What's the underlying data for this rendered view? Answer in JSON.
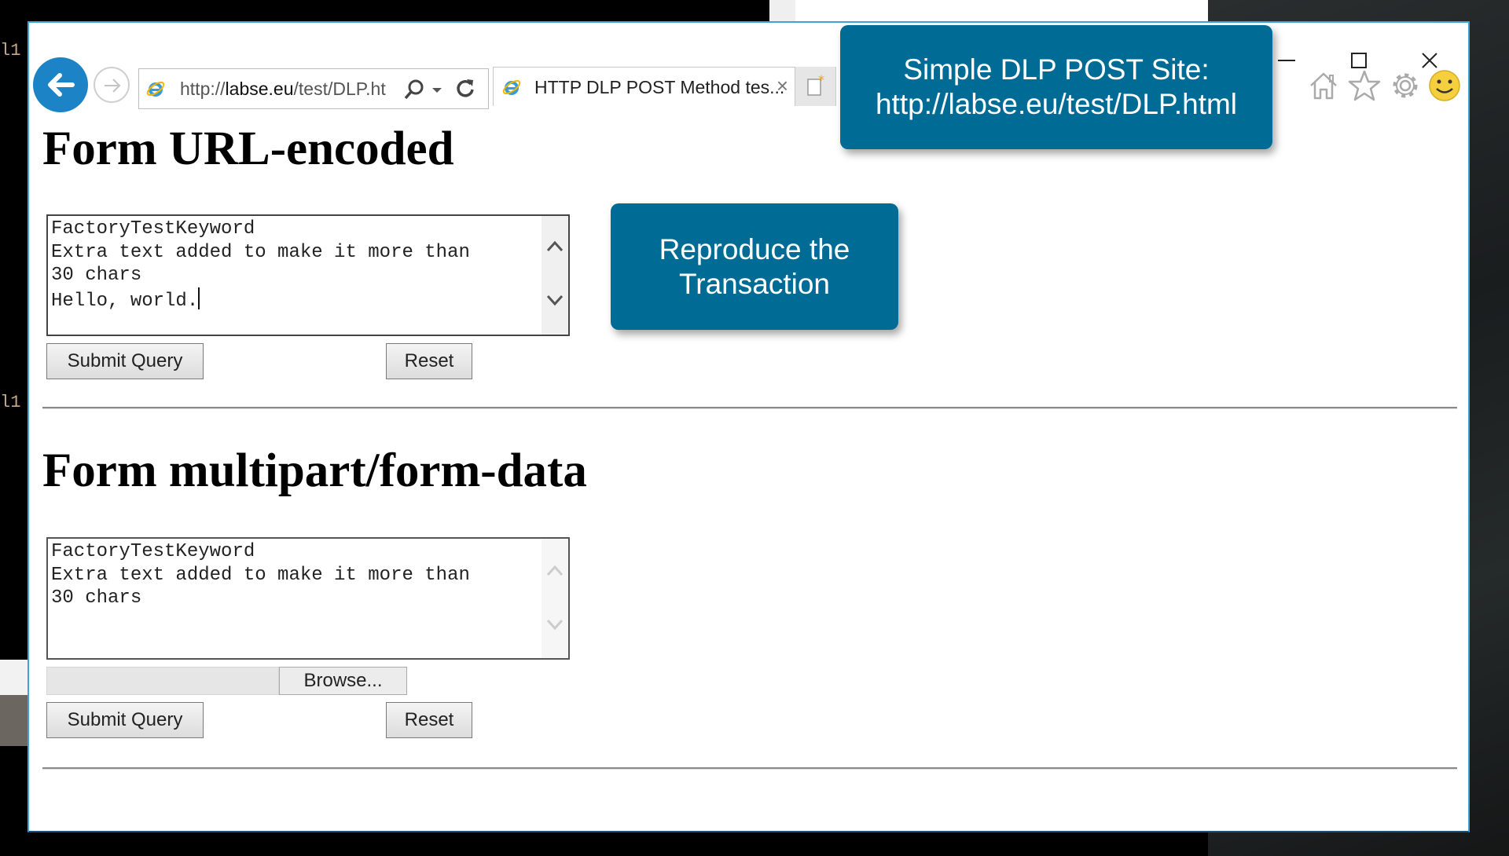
{
  "background": {
    "terminal_fragments": [
      "l1",
      "l1"
    ]
  },
  "browser": {
    "window_controls": {
      "minimize": "—",
      "maximize": "☐",
      "close": "✕"
    },
    "nav": {
      "back_icon": "back-arrow-icon",
      "forward_icon": "forward-arrow-icon"
    },
    "address_bar": {
      "url_prefix": "http://",
      "url_domain": "labse.eu",
      "url_path": "/test/DLP.ht",
      "search_icon": "search-icon",
      "dropdown_icon": "chevron-down-icon",
      "refresh_icon": "refresh-icon"
    },
    "tabs": [
      {
        "title": "HTTP DLP POST Method tes...",
        "close": "×",
        "active": true
      }
    ],
    "new_tab_icon": "new-tab-icon",
    "toolbar_icons": [
      "home-icon",
      "favorites-star-icon",
      "settings-gear-icon",
      "feedback-smiley-icon"
    ]
  },
  "page": {
    "form1": {
      "heading": "Form URL-encoded",
      "textarea_value": "FactoryTestKeyword\nExtra text added to make it more than\n30 chars\nHello, world.",
      "submit_label": "Submit Query",
      "reset_label": "Reset"
    },
    "form2": {
      "heading": "Form multipart/form-data",
      "textarea_value": "FactoryTestKeyword\nExtra text added to make it more than\n30 chars",
      "file_value": "",
      "browse_label": "Browse...",
      "submit_label": "Submit Query",
      "reset_label": "Reset"
    }
  },
  "callouts": {
    "site": {
      "line1": "Simple DLP POST Site:",
      "line2": "http://labse.eu/test/DLP.html"
    },
    "reproduce": {
      "line1": "Reproduce the",
      "line2": "Transaction"
    },
    "color": "#006c96"
  }
}
